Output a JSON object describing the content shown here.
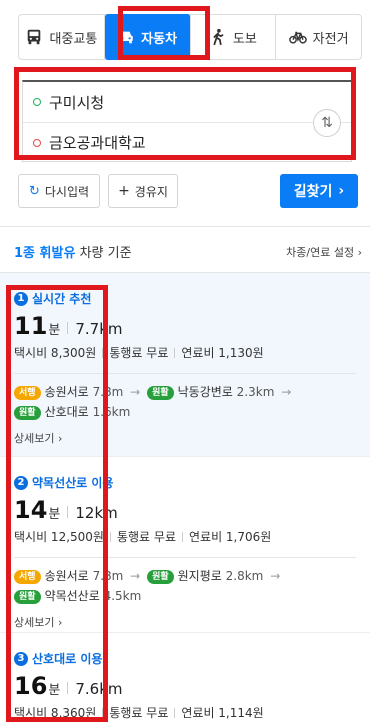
{
  "modes": [
    {
      "label": "대중교통",
      "icon": "bus-icon"
    },
    {
      "label": "자동차",
      "icon": "car-icon",
      "active": true
    },
    {
      "label": "도보",
      "icon": "walk-icon"
    },
    {
      "label": "자전거",
      "icon": "bicycle-icon"
    }
  ],
  "route": {
    "origin": "구미시청",
    "destination": "금오공과대학교"
  },
  "actions": {
    "reset": "다시입력",
    "waypoint": "경유지",
    "search": "길찾기"
  },
  "vehicle": {
    "type": "1종 휘발유",
    "suffix": "차량 기준",
    "settings": "차종/연료 설정"
  },
  "routes": [
    {
      "num": "1",
      "name": "실시간 추천",
      "time": "11",
      "time_unit": "분",
      "distance": "7.7km",
      "taxi": "택시비 8,300원",
      "toll": "통행료 무료",
      "fuel": "연료비 1,130원",
      "roads": [
        {
          "badge": "서행",
          "name": "송원서로",
          "dist": "7.8m"
        },
        {
          "badge": "원활",
          "name": "낙동강변로",
          "dist": "2.3km"
        },
        {
          "badge": "원활",
          "name": "산호대로",
          "dist": "1.6km"
        }
      ],
      "detail": "상세보기"
    },
    {
      "num": "2",
      "name": "약목선산로 이용",
      "time": "14",
      "time_unit": "분",
      "distance": "12km",
      "taxi": "택시비 12,500원",
      "toll": "통행료 무료",
      "fuel": "연료비 1,706원",
      "roads": [
        {
          "badge": "서행",
          "name": "송원서로",
          "dist": "7.8m"
        },
        {
          "badge": "원활",
          "name": "원지평로",
          "dist": "2.8km"
        },
        {
          "badge": "원활",
          "name": "약목선산로",
          "dist": "4.5km"
        }
      ],
      "detail": "상세보기"
    },
    {
      "num": "3",
      "name": "산호대로 이용",
      "time": "16",
      "time_unit": "분",
      "distance": "7.6km",
      "taxi": "택시비 8,360원",
      "toll": "통행료 무료",
      "fuel": "연료비 1,114원"
    }
  ],
  "colors": {
    "accent": "#0a7cf5",
    "highlight": "#e0171c",
    "slow": "#f5a700",
    "smooth": "#27a03b"
  }
}
